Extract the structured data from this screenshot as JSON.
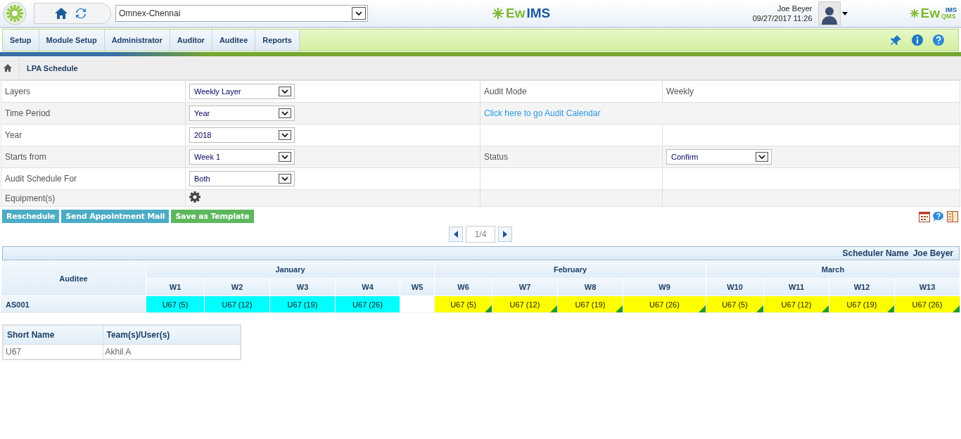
{
  "header": {
    "location": "Omnex-Chennai",
    "brand_logo": {
      "part_1": "Ew",
      "part_2": "IMS"
    },
    "user": {
      "name": "Joe Beyer",
      "datetime": "09/27/2017 11:26"
    },
    "product_logo": {
      "part_1": "Ew",
      "part_2": "IMS",
      "part_3": "QMS"
    }
  },
  "menu": [
    "Setup",
    "Module Setup",
    "Administrator",
    "Auditor",
    "Auditee",
    "Reports"
  ],
  "breadcrumb": "LPA Schedule",
  "form": [
    {
      "label": "Layers",
      "kind": "select",
      "value": "Weekly Layer",
      "right": {
        "kind": "pair",
        "label": "Audit Mode",
        "value": "Weekly"
      }
    },
    {
      "label": "Time Period",
      "kind": "select",
      "value": "Year",
      "right": {
        "kind": "link",
        "label": "Click here to go Audit Calendar"
      }
    },
    {
      "label": "Year",
      "kind": "select",
      "value": "2018",
      "right": {
        "kind": "empty"
      }
    },
    {
      "label": "Starts from",
      "kind": "select",
      "value": "Week 1",
      "right": {
        "kind": "select",
        "label": "Status",
        "value": "Confirm"
      }
    },
    {
      "label": "Audit Schedule For",
      "kind": "select",
      "value": "Both",
      "right": {
        "kind": "empty"
      }
    },
    {
      "label": "Equipment(s)",
      "kind": "gear",
      "right": {
        "kind": "empty"
      }
    }
  ],
  "actions": [
    {
      "label": "Reschedule",
      "color": "#4bacc6"
    },
    {
      "label": "Send Appointment Mail",
      "color": "#4bacc6"
    },
    {
      "label": "Save as Template",
      "color": "#5cb85c"
    }
  ],
  "pager": "1/4",
  "schedule": {
    "scheduler_label": "Scheduler Name",
    "scheduler_name": "Joe Beyer",
    "auditee_heading": "Auditee",
    "months": [
      {
        "label": "January",
        "weeks": [
          "W1",
          "W2",
          "W3",
          "W4",
          "W5"
        ]
      },
      {
        "label": "February",
        "weeks": [
          "W6",
          "W7",
          "W8",
          "W9"
        ]
      },
      {
        "label": "March",
        "weeks": [
          "W10",
          "W11",
          "W12",
          "W13"
        ]
      }
    ],
    "rows": [
      {
        "auditee": "AS001",
        "cells": [
          {
            "kind": "entry",
            "text": "U67 (5)",
            "color": "#00ffff",
            "flagged": false
          },
          {
            "kind": "entry",
            "text": "U67 (12)",
            "color": "#00ffff",
            "flagged": false
          },
          {
            "kind": "entry",
            "text": "U67 (19)",
            "color": "#00ffff",
            "flagged": false
          },
          {
            "kind": "entry",
            "text": "U67 (26)",
            "color": "#00ffff",
            "flagged": false
          },
          {
            "kind": "empty"
          },
          {
            "kind": "entry",
            "text": "U67 (5)",
            "color": "#ffff00",
            "flagged": true
          },
          {
            "kind": "entry",
            "text": "U67 (12)",
            "color": "#ffff00",
            "flagged": true
          },
          {
            "kind": "entry",
            "text": "U67 (19)",
            "color": "#ffff00",
            "flagged": true
          },
          {
            "kind": "entry",
            "text": "U67 (26)",
            "color": "#ffff00",
            "flagged": true
          },
          {
            "kind": "entry",
            "text": "U67 (5)",
            "color": "#ffff00",
            "flagged": true
          },
          {
            "kind": "entry",
            "text": "U67 (12)",
            "color": "#ffff00",
            "flagged": true
          },
          {
            "kind": "entry",
            "text": "U67 (19)",
            "color": "#ffff00",
            "flagged": true
          },
          {
            "kind": "entry",
            "text": "U67 (26)",
            "color": "#ffff00",
            "flagged": true
          }
        ]
      }
    ]
  },
  "legend": {
    "columns": [
      "Short Name",
      "Team(s)/User(s)"
    ],
    "rows": [
      [
        "U67",
        "Akhil A"
      ]
    ]
  }
}
